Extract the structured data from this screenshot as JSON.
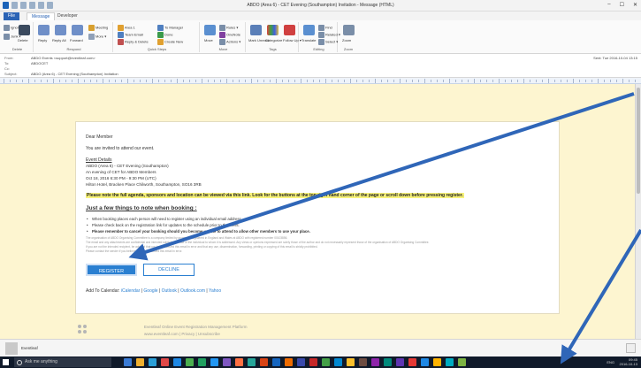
{
  "window": {
    "title": "ABDO (Area 6) - CET Evening (Southampton) Invitation  -  Message (HTML)",
    "controls": [
      "–",
      "☐",
      "✕"
    ]
  },
  "tabs": [
    "File",
    "Message",
    "Developer"
  ],
  "ribbon": {
    "delete_group": {
      "label": "Delete",
      "ignore": "Ignore",
      "junk": "Junk ▾",
      "delete": "Delete"
    },
    "respond_group": {
      "label": "Respond",
      "reply": "Reply",
      "reply_all": "Reply All",
      "forward": "Forward",
      "meeting": "Meeting",
      "more": "More ▾"
    },
    "quick_steps_group": {
      "label": "Quick Steps",
      "items": [
        "Area 1",
        "Team Email",
        "Reply & Delete",
        "To Manager",
        "Done",
        "Create New"
      ]
    },
    "move_group": {
      "label": "Move",
      "move": "Move",
      "rules": "Rules ▾",
      "onenote": "OneNote",
      "actions": "Actions ▾"
    },
    "tags_group": {
      "label": "Tags",
      "mark_unread": "Mark Unread",
      "categorize": "Categorize",
      "follow_up": "Follow Up ▾"
    },
    "editing_group": {
      "label": "Editing",
      "translate": "Translate",
      "find": "Find",
      "related": "Related ▾",
      "select": "Select ▾"
    },
    "zoom_group": {
      "label": "Zoom",
      "zoom": "Zoom"
    }
  },
  "header": {
    "from_label": "From:",
    "from": "ABDO Events <support@eventleaf.com>",
    "to_label": "To:",
    "to": "ABDOCET",
    "cc_label": "Cc:",
    "cc": "",
    "subject_label": "Subject:",
    "subject": "ABDO (Area 6) - CET Evening (Southampton) Invitation",
    "sent": "Sent:  Tue 2016-10-04 13:15"
  },
  "email": {
    "greeting": "Dear Member",
    "intro": "You are invited to attend our event.",
    "details_heading": "Event Details",
    "event_lines": [
      "ABDO (Area 6) - CET Evening (Southampton)",
      "An evening of CET for ABDO Members",
      "Oct 18, 2016 6:30 PM - 9:30 PM (UTC)",
      "Hilton Hotel, Bracken Place Chilworth, Southampton, SO16 3RB"
    ],
    "highlight_note": "Please note the full agenda, sponsors and location can be viewed via this link. Look for the buttons at the top right hand corner of the page or scroll down before pressing register.",
    "things_heading": "Just a few things to note when booking :",
    "bullets": [
      "When booking places each person will need to register using an individual email address.",
      "Please check back on the registration link for updates to the schedule prior to the event.",
      "Please remember to cancel your booking should you become unable to attend to allow other members to use your place."
    ],
    "fine_print": [
      "The organisation of ABDO Organising Committee is a company limited by guarantee registered in England and Wales at ABDO with registered number 00103856.",
      "The email and any attachments are confidential and intended solely for the use of the individual to whom it is addressed. Any views or opinions expressed are solely those of the author and do not necessarily represent those of the organisation of ABDO Organising Committee.",
      "If you are not the intended recipient, be advised that you have received this email in error and that any use, dissemination, forwarding, printing or copying of this email is strictly prohibited.",
      "Please contact the sender if you believe you have received this email in error."
    ],
    "register_label": "REGISTER",
    "decline_label": "DECLINE",
    "calendar_prefix": "Add To Calendar: ",
    "calendar_links": [
      "iCalendar",
      "Google",
      "Outlook",
      "Outlook.com",
      "Yahoo"
    ],
    "footer_line1": "Eventleaf Online Event Registration Management Platform",
    "footer_line2": "www.eventleaf.com | Privacy | Unsubscribe"
  },
  "people_pane": {
    "name": "Eventleaf"
  },
  "taskbar": {
    "search_placeholder": "Ask me anything",
    "lang": "ENG",
    "time": "09:45",
    "date": "2016-10-13"
  },
  "colors": {
    "accent": "#2a7fd1",
    "arrow": "#2f66b8",
    "highlight": "#f8f37a",
    "body_bg": "#fdf5d0"
  }
}
